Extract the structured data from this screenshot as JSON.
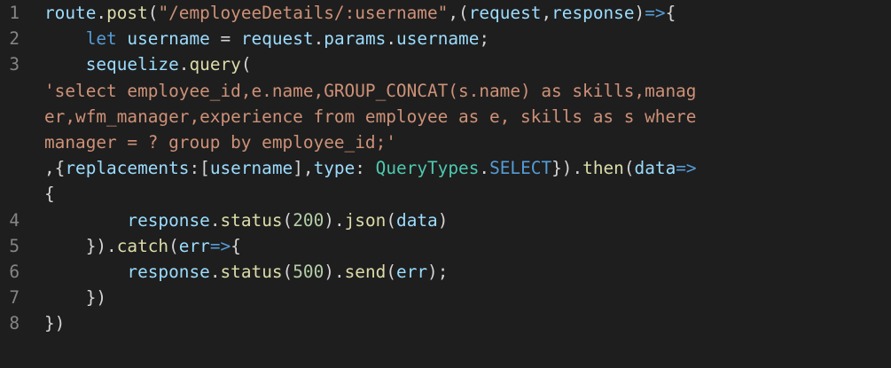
{
  "lines": [
    {
      "num": "1",
      "tokens": [
        "route",
        ".",
        "post",
        "(",
        "\"/employeeDetails/:username\"",
        ",(",
        "request",
        ",",
        "response",
        ")",
        "=>",
        "{"
      ]
    },
    {
      "num": "2",
      "tokens": [
        "    ",
        "let",
        " ",
        "username",
        " = ",
        "request",
        ".",
        "params",
        ".",
        "username",
        ";"
      ]
    },
    {
      "num": "3",
      "tokens": [
        "    ",
        "sequelize",
        ".",
        "query",
        "("
      ]
    },
    {
      "num": "",
      "tokens": [
        "'select employee_id,e.name,GROUP_CONCAT(s.name) as skills,manag"
      ]
    },
    {
      "num": "",
      "tokens": [
        "er,wfm_manager,experience from employee as e, skills as s where"
      ]
    },
    {
      "num": "",
      "tokens": [
        "manager = ? group by employee_id;'"
      ]
    },
    {
      "num": "",
      "tokens": [
        ",{",
        "replacements",
        ":[",
        "username",
        "],",
        "type",
        ": ",
        "QueryTypes",
        ".",
        "SELECT",
        "}).",
        "then",
        "(",
        "data",
        "=>"
      ]
    },
    {
      "num": "",
      "tokens": [
        "{"
      ]
    },
    {
      "num": "4",
      "tokens": [
        "        ",
        "response",
        ".",
        "status",
        "(",
        "200",
        ").",
        "json",
        "(",
        "data",
        ")"
      ]
    },
    {
      "num": "5",
      "tokens": [
        "    ",
        "}).",
        "catch",
        "(",
        "err",
        "=>",
        "{"
      ]
    },
    {
      "num": "6",
      "tokens": [
        "        ",
        "response",
        ".",
        "status",
        "(",
        "500",
        ").",
        "send",
        "(",
        "err",
        ");"
      ]
    },
    {
      "num": "7",
      "tokens": [
        "    ",
        "})"
      ]
    },
    {
      "num": "8",
      "tokens": [
        "})"
      ]
    }
  ]
}
